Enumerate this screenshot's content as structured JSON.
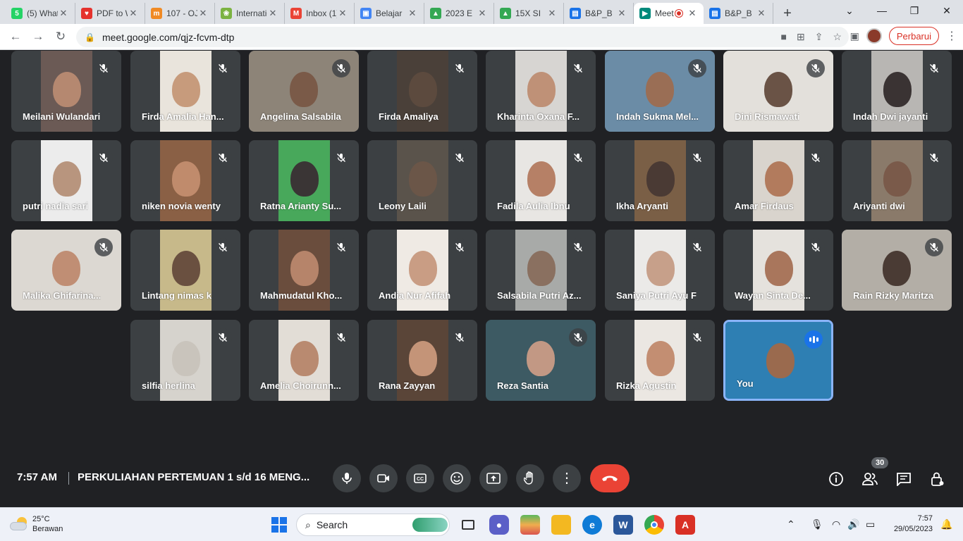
{
  "browser": {
    "tabs": [
      {
        "title": "(5) WhatsApp",
        "favicon_color": "#25d366",
        "favicon_glyph": "5"
      },
      {
        "title": "PDF to Word",
        "favicon_color": "#e5322d",
        "favicon_glyph": "♥"
      },
      {
        "title": "107 - OJS",
        "favicon_color": "#f08a24",
        "favicon_glyph": "m"
      },
      {
        "title": "International",
        "favicon_color": "#7cb342",
        "favicon_glyph": "❀"
      },
      {
        "title": "Inbox (1)",
        "favicon_color": "#ea4335",
        "favicon_glyph": "M"
      },
      {
        "title": "Belajar",
        "favicon_color": "#4285f4",
        "favicon_glyph": "▣"
      },
      {
        "title": "2023 E",
        "favicon_color": "#34a853",
        "favicon_glyph": "▲"
      },
      {
        "title": "15X SI",
        "favicon_color": "#34a853",
        "favicon_glyph": "▲"
      },
      {
        "title": "B&P_B",
        "favicon_color": "#1a73e8",
        "favicon_glyph": "▤"
      },
      {
        "title": "Meet",
        "favicon_color": "#00897b",
        "favicon_glyph": "▶",
        "active": true
      },
      {
        "title": "B&P_B",
        "favicon_color": "#1a73e8",
        "favicon_glyph": "▤"
      }
    ],
    "url": "meet.google.com/qjz-fcvm-dtp",
    "update_label": "Perbarui"
  },
  "meet": {
    "participants": [
      {
        "name": "Meilani Wulandari",
        "bg": "#6b5a55",
        "skin": "#b58870"
      },
      {
        "name": "Firda Amalia Han...",
        "bg": "#e9e4dc",
        "skin": "#c79b7c"
      },
      {
        "name": "Angelina Salsabila",
        "bg": "#8d8478",
        "skin": "#7a5a48"
      },
      {
        "name": "Firda Amaliya",
        "bg": "#4a4039",
        "skin": "#5c4a3e"
      },
      {
        "name": "Kharinta Oxana F...",
        "bg": "#d7d5d2",
        "skin": "#bf9177"
      },
      {
        "name": "Indah Sukma Mel...",
        "bg": "#6b8ca6",
        "skin": "#9a6e55"
      },
      {
        "name": "Dini Rismawati",
        "bg": "#e3e0db",
        "skin": "#6a5346"
      },
      {
        "name": "Indah Dwi jayanti",
        "bg": "#b8b6b3",
        "skin": "#3a3333"
      },
      {
        "name": "putri nadia sari",
        "bg": "#ececec",
        "skin": "#b8957e"
      },
      {
        "name": "niken novia wenty",
        "bg": "#8a6045",
        "skin": "#c08b6c"
      },
      {
        "name": "Ratna Arianty Su...",
        "bg": "#48a85b",
        "skin": "#3a3535"
      },
      {
        "name": "Leony Laili",
        "bg": "#5a534b",
        "skin": "#6b5648"
      },
      {
        "name": "Fadila Aulia Ibnu",
        "bg": "#e8e6e3",
        "skin": "#b68066"
      },
      {
        "name": "Ikha Aryanti",
        "bg": "#7a5f46",
        "skin": "#4a3a34"
      },
      {
        "name": "Amar Firdaus",
        "bg": "#d9d4cd",
        "skin": "#b27b5d"
      },
      {
        "name": "Ariyanti dwi",
        "bg": "#8a7a6a",
        "skin": "#7a5a4a"
      },
      {
        "name": "Malika Ghifarina...",
        "bg": "#dcd8d2",
        "skin": "#c08e74"
      },
      {
        "name": "Lintang nimas k",
        "bg": "#c7b98a",
        "skin": "#6a5040"
      },
      {
        "name": "Mahmudatul Kho...",
        "bg": "#6a4d3d",
        "skin": "#b6846a"
      },
      {
        "name": "Andia Nur Afifah",
        "bg": "#efeae4",
        "skin": "#c99d84"
      },
      {
        "name": "Salsabila Putri Az...",
        "bg": "#a8aaa8",
        "skin": "#8a7060"
      },
      {
        "name": "Saniya Putri Ayu F",
        "bg": "#ebeae8",
        "skin": "#c7a08a"
      },
      {
        "name": "Wayan Sinta De...",
        "bg": "#e5e2dd",
        "skin": "#a9765c"
      },
      {
        "name": "Rain Rizky Maritza",
        "bg": "#b3aea6",
        "skin": "#4a3b34"
      },
      {
        "name": "silfia herlina",
        "bg": "#d6d3cd",
        "skin": "#c9c4bc"
      },
      {
        "name": "Amelia Choirunn...",
        "bg": "#e2ddd6",
        "skin": "#b98a70"
      },
      {
        "name": "Rana Zayyan",
        "bg": "#5a4538",
        "skin": "#c49478"
      },
      {
        "name": "Reza Santia",
        "bg": "#3d5a63",
        "skin": "#c29884"
      },
      {
        "name": "Rizka Agustin",
        "bg": "#ebe7e2",
        "skin": "#c38e72"
      },
      {
        "name": "You",
        "bg": "#2e7fb3",
        "skin": "#9a6a4e",
        "self": true
      }
    ],
    "clock": "7:57 AM",
    "meeting_title": "PERKULIAHAN PERTEMUAN 1 s/d 16 MENG...",
    "participant_count": "30",
    "accent_color": "#8ab4f8",
    "hangup_color": "#ea4335"
  },
  "taskbar": {
    "weather_temp": "25°C",
    "weather_desc": "Berawan",
    "search_placeholder": "Search",
    "time": "7:57",
    "date": "29/05/2023"
  }
}
